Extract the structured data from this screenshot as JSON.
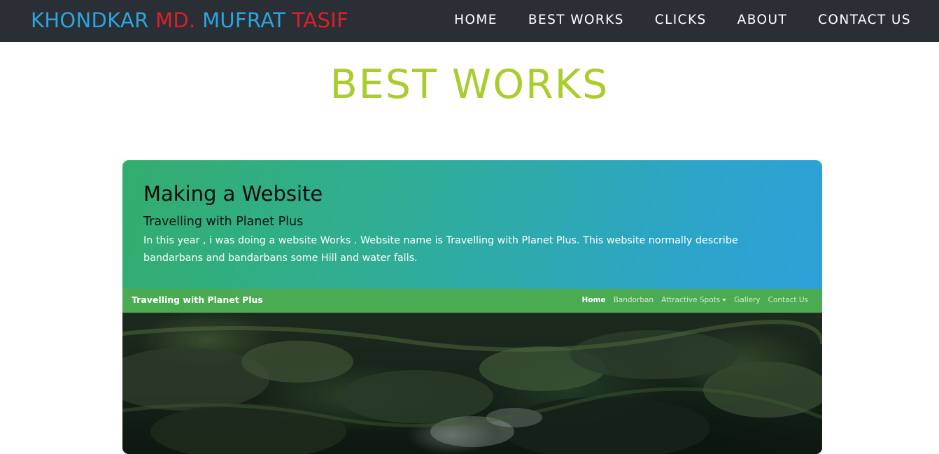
{
  "navbar": {
    "brand_part1": "KHONDKAR ",
    "brand_part2": "MD. ",
    "brand_part3": "MUFRAT ",
    "brand_part4": "TASIF",
    "brand_color_primary": "#2aa5df",
    "brand_color_secondary": "#dc1f2a",
    "links": [
      {
        "label": "HOME"
      },
      {
        "label": "BEST WORKS"
      },
      {
        "label": "CLICKS"
      },
      {
        "label": "ABOUT"
      },
      {
        "label": "CONTACT US"
      }
    ]
  },
  "page": {
    "title": "BEST WORKS",
    "title_color": "#a9cd2c"
  },
  "card": {
    "title": "Making a Website",
    "subtitle": "Travelling with Planet Plus",
    "description": "In this year , i was doing a website Works . Website name is Travelling with Planet Plus. This website normally describe bandarbans and bandarbans some Hill and water falls."
  },
  "screenshot": {
    "brand": "Travelling with Planet Plus",
    "nav": [
      {
        "label": "Home"
      },
      {
        "label": "Bandorban"
      },
      {
        "label": "Attractive Spots"
      },
      {
        "label": "Gallery"
      },
      {
        "label": "Contact Us"
      }
    ]
  }
}
